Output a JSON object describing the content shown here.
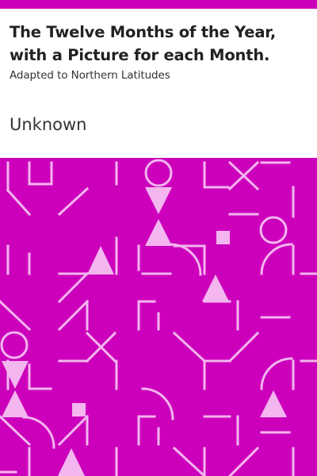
{
  "book": {
    "title": "The Twelve Months of the Year, with a Picture for each Month.",
    "subtitle": "Adapted to Northern Latitudes",
    "author": "Unknown"
  },
  "colors": {
    "bar": "#cc00bb",
    "pattern_bg": "#cc00bb",
    "pattern_stroke": "#f3b6ef",
    "text_dark": "#222222"
  }
}
